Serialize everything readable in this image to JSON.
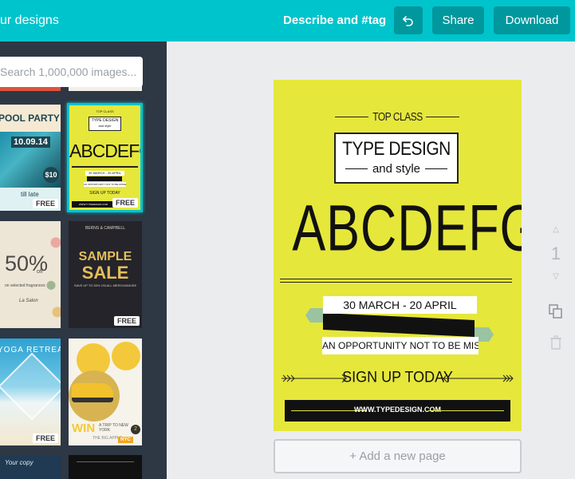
{
  "topbar": {
    "designs_label": "ur designs",
    "describe_label": "Describe and #tag",
    "undo_icon": "undo-icon",
    "share_label": "Share",
    "download_label": "Download"
  },
  "sidebar": {
    "search_placeholder": "Search 1,000,000 images...",
    "free_badge": "FREE",
    "thumbs": {
      "pool_party": {
        "title": "POOL PARTY",
        "date": "10.09.14",
        "price": "$10",
        "sub": "till late"
      },
      "type_design": {
        "top": "TOP CLASS",
        "title": "TYPE DESIGN",
        "sub": "and style",
        "big": "ABCDEFG",
        "ribbon": "30 MARCH - 20 APRIL",
        "ribbon2": "AN OPPORTUNITY NOT TO BE MISSED",
        "cta": "SIGN UP TODAY",
        "url": "WWW.TYPEDESIGN.COM"
      },
      "fifty_off": {
        "value": "50%",
        "off": "off",
        "line": "on selected fragrances",
        "brand": "La Salon"
      },
      "sample_sale": {
        "top": "BERNS & CAMPBELL",
        "title1": "SAMPLE",
        "title2": "SALE",
        "sub": "SAVE UP TO 50% ON ALL MERCHANDISE"
      },
      "yoga": {
        "title": "YOGA RETREAT"
      },
      "taxi": {
        "title1": "WIN",
        "title2": "A TRIP TO NEW YORK",
        "sub": "THE BIG APPLE",
        "tag": "NYC",
        "num": "2"
      },
      "bottom": {
        "title": "Your copy"
      }
    }
  },
  "poster": {
    "top_label": "TOP CLASS",
    "title": "TYPE DESIGN",
    "subtitle": "and style",
    "big": "ABCDEFG",
    "date_range": "30 MARCH - 20 APRIL",
    "opportunity": "AN OPPORTUNITY NOT TO BE MISSED",
    "cta": "SIGN UP TODAY",
    "url": "WWW.TYPEDESIGN.COM"
  },
  "canvas": {
    "add_page": "+ Add a new page",
    "page_number": "1"
  },
  "colors": {
    "accent": "#00c4cc",
    "button": "#00979d",
    "panel": "#2e3744",
    "poster_bg": "#e6e73b",
    "ribbon_green": "#9ac3a1"
  }
}
